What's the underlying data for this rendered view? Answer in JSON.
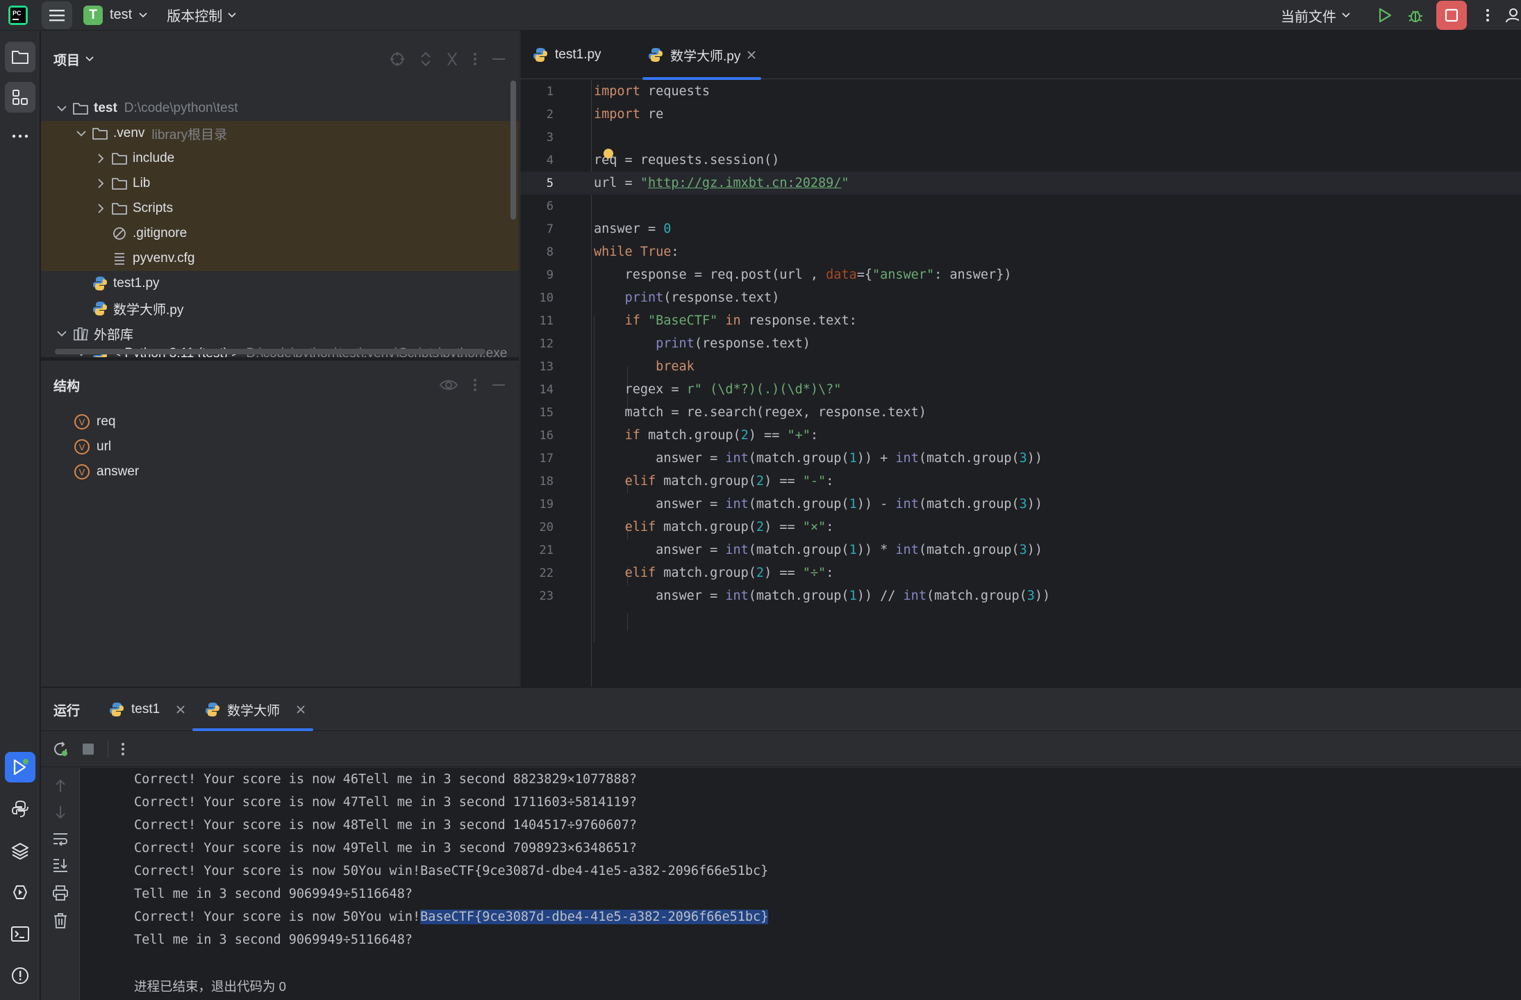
{
  "titlebar": {
    "project_initial": "T",
    "project_name": "test",
    "vcs_label": "版本控制",
    "run_config": "当前文件",
    "accent": "#3574f0",
    "stop_color": "#db5c5c"
  },
  "project_panel": {
    "title": "项目",
    "tree": [
      {
        "label": "test",
        "hint": "D:\\code\\python\\test",
        "icon": "folder-icon"
      },
      {
        "label": ".venv",
        "hint": "library根目录",
        "icon": "folder-icon"
      },
      {
        "label": "include",
        "icon": "folder-icon"
      },
      {
        "label": "Lib",
        "icon": "folder-icon"
      },
      {
        "label": "Scripts",
        "icon": "folder-icon"
      },
      {
        "label": ".gitignore",
        "icon": "ignore-file-icon"
      },
      {
        "label": "pyvenv.cfg",
        "icon": "config-file-icon"
      },
      {
        "label": "test1.py",
        "icon": "python-file-icon"
      },
      {
        "label": "数学大师.py",
        "icon": "python-file-icon"
      },
      {
        "label": "外部库",
        "icon": "library-icon"
      },
      {
        "label": "< Python 3.11 (test) >",
        "hint": "D:\\code\\python\\test\\.venv\\Scripts\\python.exe",
        "icon": "python-sdk-icon"
      }
    ]
  },
  "structure_panel": {
    "title": "结构",
    "items": [
      "req",
      "url",
      "answer"
    ],
    "badge": "V"
  },
  "editor": {
    "tabs": [
      {
        "label": "test1.py"
      },
      {
        "label": "数学大师.py"
      }
    ],
    "current_line": 5
  },
  "run_panel": {
    "title": "运行",
    "tabs": [
      {
        "label": "test1"
      },
      {
        "label": "数学大师"
      }
    ],
    "console": [
      "Correct! Your score is now 46Tell me in 3 second 8823829×1077888?",
      "Correct! Your score is now 47Tell me in 3 second 1711603÷5814119?",
      "Correct! Your score is now 48Tell me in 3 second 1404517÷9760607?",
      "Correct! Your score is now 49Tell me in 3 second 7098923×6348651?",
      "Correct! Your score is now 50You win!BaseCTF{9ce3087d-dbe4-41e5-a382-2096f66e51bc}",
      "Tell me in 3 second 9069949÷5116648?",
      "Tell me in 3 second 9069949÷5116648?"
    ],
    "selected_line_prefix": "Correct! Your score is now 50You win!",
    "selected_text": "BaseCTF{9ce3087d-dbe4-41e5-a382-2096f66e51bc}",
    "exit_message": "进程已结束，退出代码为 0"
  }
}
